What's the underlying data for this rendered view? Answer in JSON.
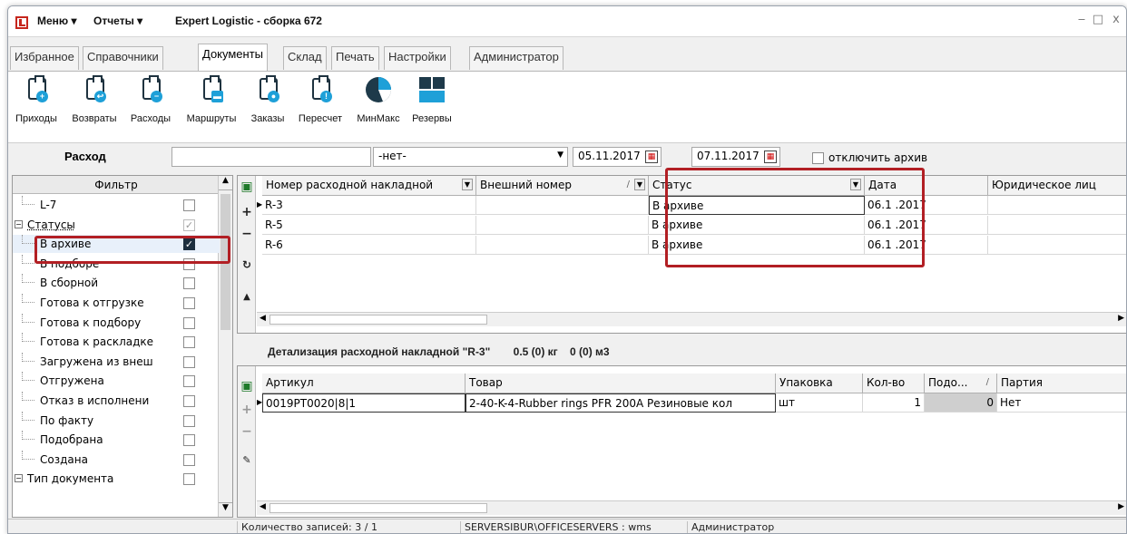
{
  "titlebar": {
    "menu": "Меню",
    "reports": "Отчеты",
    "app_title": "Expert Logistic - сборка 672"
  },
  "tabs": [
    "Избранное",
    "Справочники",
    "Документы",
    "Склад",
    "Печать",
    "Настройки",
    "Администратор"
  ],
  "active_tab": "Документы",
  "toolbar": [
    "Приходы",
    "Возвраты",
    "Расходы",
    "Маршруты",
    "Заказы",
    "Пересчет",
    "МинМакс",
    "Резервы"
  ],
  "filterbar": {
    "label": "Расход",
    "search_value": "",
    "select_value": "-нет-",
    "date_from": "05.11.2017",
    "date_to": "07.11.2017",
    "archive_label": "отключить архив"
  },
  "filter_panel": {
    "header": "Фильтр",
    "items": [
      {
        "label": "L-7",
        "level": 2,
        "checked": false
      },
      {
        "label": "Статусы",
        "level": 1,
        "checked": true,
        "gray": true,
        "group": true
      },
      {
        "label": "В архиве",
        "level": 2,
        "checked": true,
        "selected": true
      },
      {
        "label": "В подборе",
        "level": 2,
        "checked": false
      },
      {
        "label": "В сборной",
        "level": 2,
        "checked": false
      },
      {
        "label": "Готова к отгрузке",
        "level": 2,
        "checked": false
      },
      {
        "label": "Готова к подбору",
        "level": 2,
        "checked": false
      },
      {
        "label": "Готова к раскладке",
        "level": 2,
        "checked": false
      },
      {
        "label": "Загружена из внеш",
        "level": 2,
        "checked": false
      },
      {
        "label": "Отгружена",
        "level": 2,
        "checked": false
      },
      {
        "label": "Отказ в исполнени",
        "level": 2,
        "checked": false
      },
      {
        "label": "По факту",
        "level": 2,
        "checked": false
      },
      {
        "label": "Подобрана",
        "level": 2,
        "checked": false
      },
      {
        "label": "Создана",
        "level": 2,
        "checked": false
      },
      {
        "label": "Тип документа",
        "level": 1,
        "checked": false,
        "group": true
      }
    ]
  },
  "grid": {
    "columns": [
      "Номер расходной накладной",
      "Внешний номер",
      "Статус",
      "Дата",
      "Юридическое лиц"
    ],
    "rows": [
      {
        "number": "R-3",
        "ext": "",
        "status": "В архиве",
        "date": "06.1 .2017"
      },
      {
        "number": "R-5",
        "ext": "",
        "status": "В архиве",
        "date": "06.1 .2017"
      },
      {
        "number": "R-6",
        "ext": "",
        "status": "В архиве",
        "date": "06.1 .2017"
      }
    ]
  },
  "detail": {
    "title": "Детализация расходной накладной \"R-3\"",
    "weight": "0.5 (0) кг",
    "volume": "0 (0) м3",
    "columns": [
      "Артикул",
      "Товар",
      "Упаковка",
      "Кол-во",
      "Подо...",
      "Партия"
    ],
    "rows": [
      {
        "article": "0019PT0020|8|1",
        "product": "2-40-K-4-Rubber rings PFR 200A Резиновые кол",
        "pack": "шт",
        "qty": "1",
        "picked": "0",
        "batch": "Нет"
      }
    ]
  },
  "statusbar": {
    "records": "Количество записей: 3 / 1",
    "server": "SERVERSIBUR\\OFFICESERVERS : wms",
    "user": "Администратор"
  }
}
